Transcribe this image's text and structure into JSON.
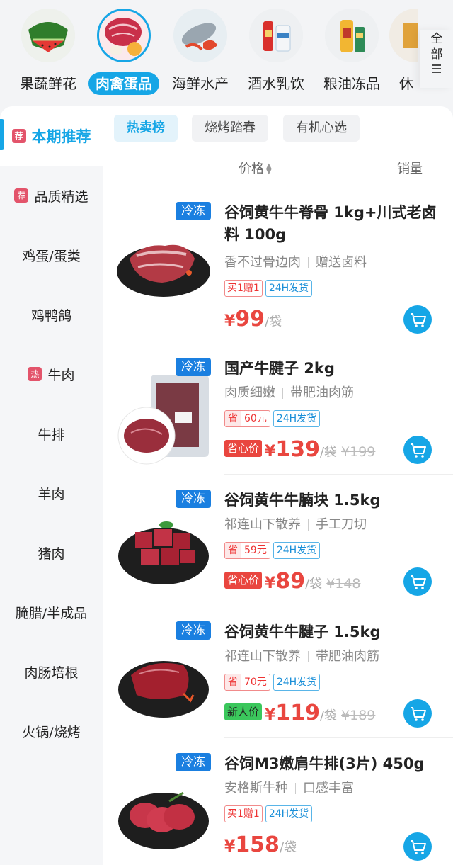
{
  "top_categories": [
    {
      "label": "果蔬鲜花",
      "icon": "watermelon-icon"
    },
    {
      "label": "肉禽蛋品",
      "icon": "meat-icon",
      "active": true
    },
    {
      "label": "海鲜水产",
      "icon": "seafood-icon"
    },
    {
      "label": "酒水乳饮",
      "icon": "drinks-icon"
    },
    {
      "label": "粮油冻品",
      "icon": "oil-icon"
    },
    {
      "label": "休",
      "icon": "snack-icon"
    }
  ],
  "all_button": {
    "chars": [
      "全",
      "部"
    ],
    "icon": "menu-icon"
  },
  "sidebar": {
    "items": [
      {
        "label": "本期推荐",
        "badge": "荐",
        "active": true
      },
      {
        "label": "品质精选",
        "badge": "荐"
      },
      {
        "label": "鸡蛋/蛋类"
      },
      {
        "label": "鸡鸭鸽"
      },
      {
        "label": "牛肉",
        "badge": "热"
      },
      {
        "label": "牛排"
      },
      {
        "label": "羊肉"
      },
      {
        "label": "猪肉"
      },
      {
        "label": "腌腊/半成品"
      },
      {
        "label": "肉肠培根"
      },
      {
        "label": "火锅/烧烤"
      }
    ]
  },
  "subtabs": [
    "热卖榜",
    "烧烤踏春",
    "有机心选"
  ],
  "sort": {
    "price": "价格",
    "sales": "销量"
  },
  "products": [
    {
      "tag": "冷冻",
      "title": "谷饲黄牛牛脊骨 1kg+川式老卤料 100g",
      "sub1": "香不过骨边肉",
      "sub2": "赠送卤料",
      "tag1": "买1赠1",
      "tag2": "24H发货",
      "yen": "¥",
      "price": "99",
      "unit": "/袋"
    },
    {
      "tag": "冷冻",
      "title": "国产牛腱子 2kg",
      "sub1": "肉质细嫩",
      "sub2": "带肥油肉筋",
      "save_label": "省",
      "save_amt": "60元",
      "tag2": "24H发货",
      "price_badge": "省心价",
      "yen": "¥",
      "price": "139",
      "unit": "/袋",
      "orig": "¥199"
    },
    {
      "tag": "冷冻",
      "title": "谷饲黄牛牛腩块 1.5kg",
      "sub1": "祁连山下散养",
      "sub2": "手工刀切",
      "save_label": "省",
      "save_amt": "59元",
      "tag2": "24H发货",
      "price_badge": "省心价",
      "yen": "¥",
      "price": "89",
      "unit": "/袋",
      "orig": "¥148"
    },
    {
      "tag": "冷冻",
      "title": "谷饲黄牛牛腱子 1.5kg",
      "sub1": "祁连山下散养",
      "sub2": "带肥油肉筋",
      "save_label": "省",
      "save_amt": "70元",
      "tag2": "24H发货",
      "price_badge": "新人价",
      "yen": "¥",
      "price": "119",
      "unit": "/袋",
      "orig": "¥189"
    },
    {
      "tag": "冷冻",
      "title": "谷饲M3嫩肩牛排(3片) 450g",
      "sub1": "安格斯牛种",
      "sub2": "口感丰富",
      "tag1": "买1赠1",
      "tag2": "24H发货",
      "yen": "¥",
      "price": "158",
      "unit": "/袋"
    }
  ],
  "colors": {
    "accent": "#16a6e6",
    "price": "#e9463f",
    "frozen_tag": "#1a7fe0"
  }
}
